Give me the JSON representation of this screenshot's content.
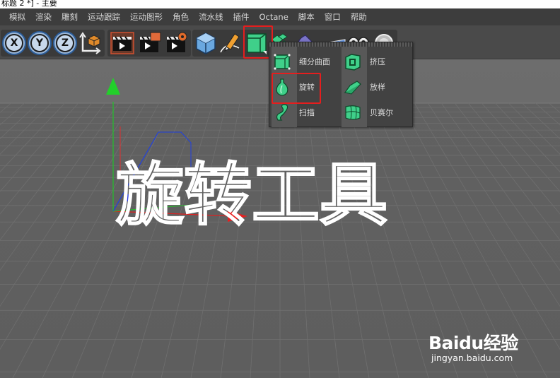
{
  "window": {
    "title": "标题 2 *] - 主要"
  },
  "menu": [
    "模拟",
    "渲染",
    "雕刻",
    "运动跟踪",
    "运动图形",
    "角色",
    "流水线",
    "插件",
    "Octane",
    "脚本",
    "窗口",
    "帮助"
  ],
  "toolbar": {
    "axis_buttons": [
      "X",
      "Y",
      "Z"
    ]
  },
  "popup": {
    "items": [
      {
        "label": "细分曲面",
        "icon": "subdivision-surface-icon"
      },
      {
        "label": "挤压",
        "icon": "extrude-icon"
      },
      {
        "label": "旋转",
        "icon": "lathe-icon"
      },
      {
        "label": "放样",
        "icon": "loft-icon"
      },
      {
        "label": "扫描",
        "icon": "sweep-icon"
      },
      {
        "label": "贝赛尔",
        "icon": "bezier-icon"
      }
    ]
  },
  "viewport": {
    "overlay_text": "旋转工具"
  },
  "watermark": {
    "logo": "Baidu经验",
    "url": "jingyan.baidu.com"
  },
  "colors": {
    "highlight": "#e51e1e",
    "accent_green": "#3fd08a",
    "viewport_bg": "#666666"
  }
}
